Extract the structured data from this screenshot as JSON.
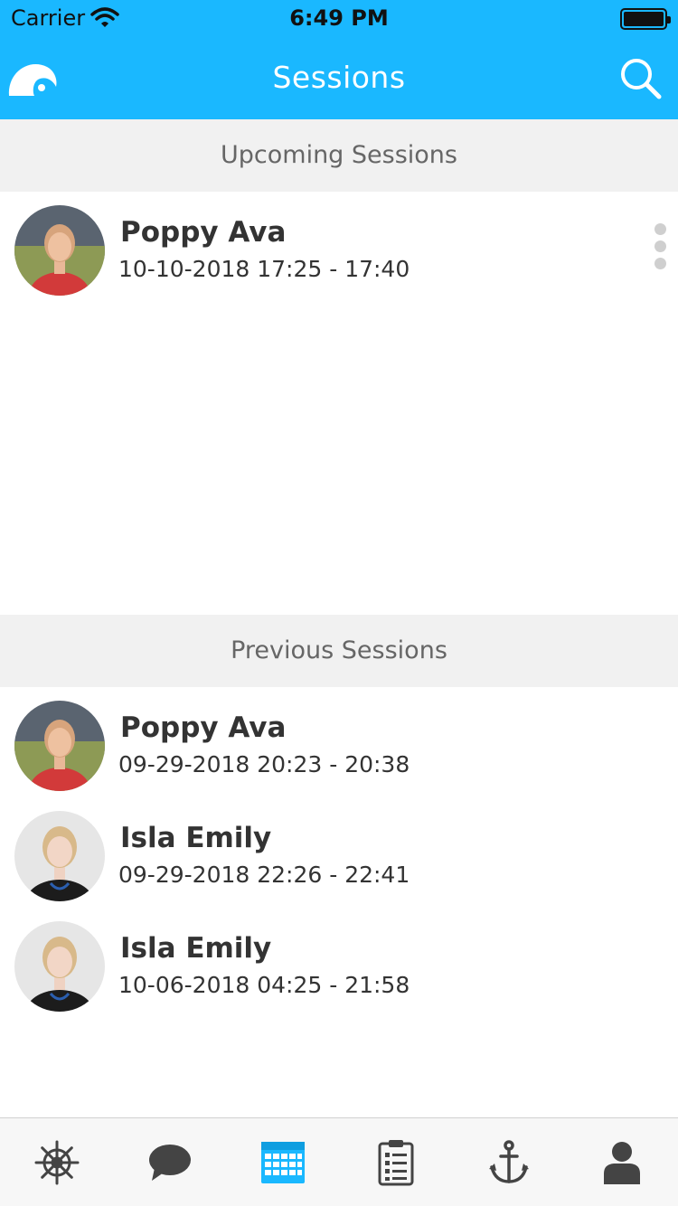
{
  "status_bar": {
    "carrier": "Carrier",
    "time": "6:49 PM"
  },
  "header": {
    "title": "Sessions"
  },
  "sections": {
    "upcoming": {
      "title": "Upcoming Sessions",
      "items": [
        {
          "name": "Poppy Ava",
          "time": "10-10-2018 17:25 - 17:40"
        }
      ]
    },
    "previous": {
      "title": "Previous Sessions",
      "items": [
        {
          "name": "Poppy Ava",
          "time": "09-29-2018 20:23 - 20:38"
        },
        {
          "name": "Isla Emily",
          "time": "09-29-2018 22:26 - 22:41"
        },
        {
          "name": "Isla Emily",
          "time": "10-06-2018 04:25 - 21:58"
        }
      ]
    }
  },
  "tabbar": {
    "items": [
      "helm-icon",
      "chat-bubble-icon",
      "calendar-icon",
      "checklist-icon",
      "anchor-icon",
      "person-icon"
    ],
    "active": "calendar-icon"
  },
  "colors": {
    "accent": "#1ab8ff",
    "section_bg": "#f1f1f1",
    "tab_icon": "#444444",
    "tab_active": "#1ab8ff"
  }
}
